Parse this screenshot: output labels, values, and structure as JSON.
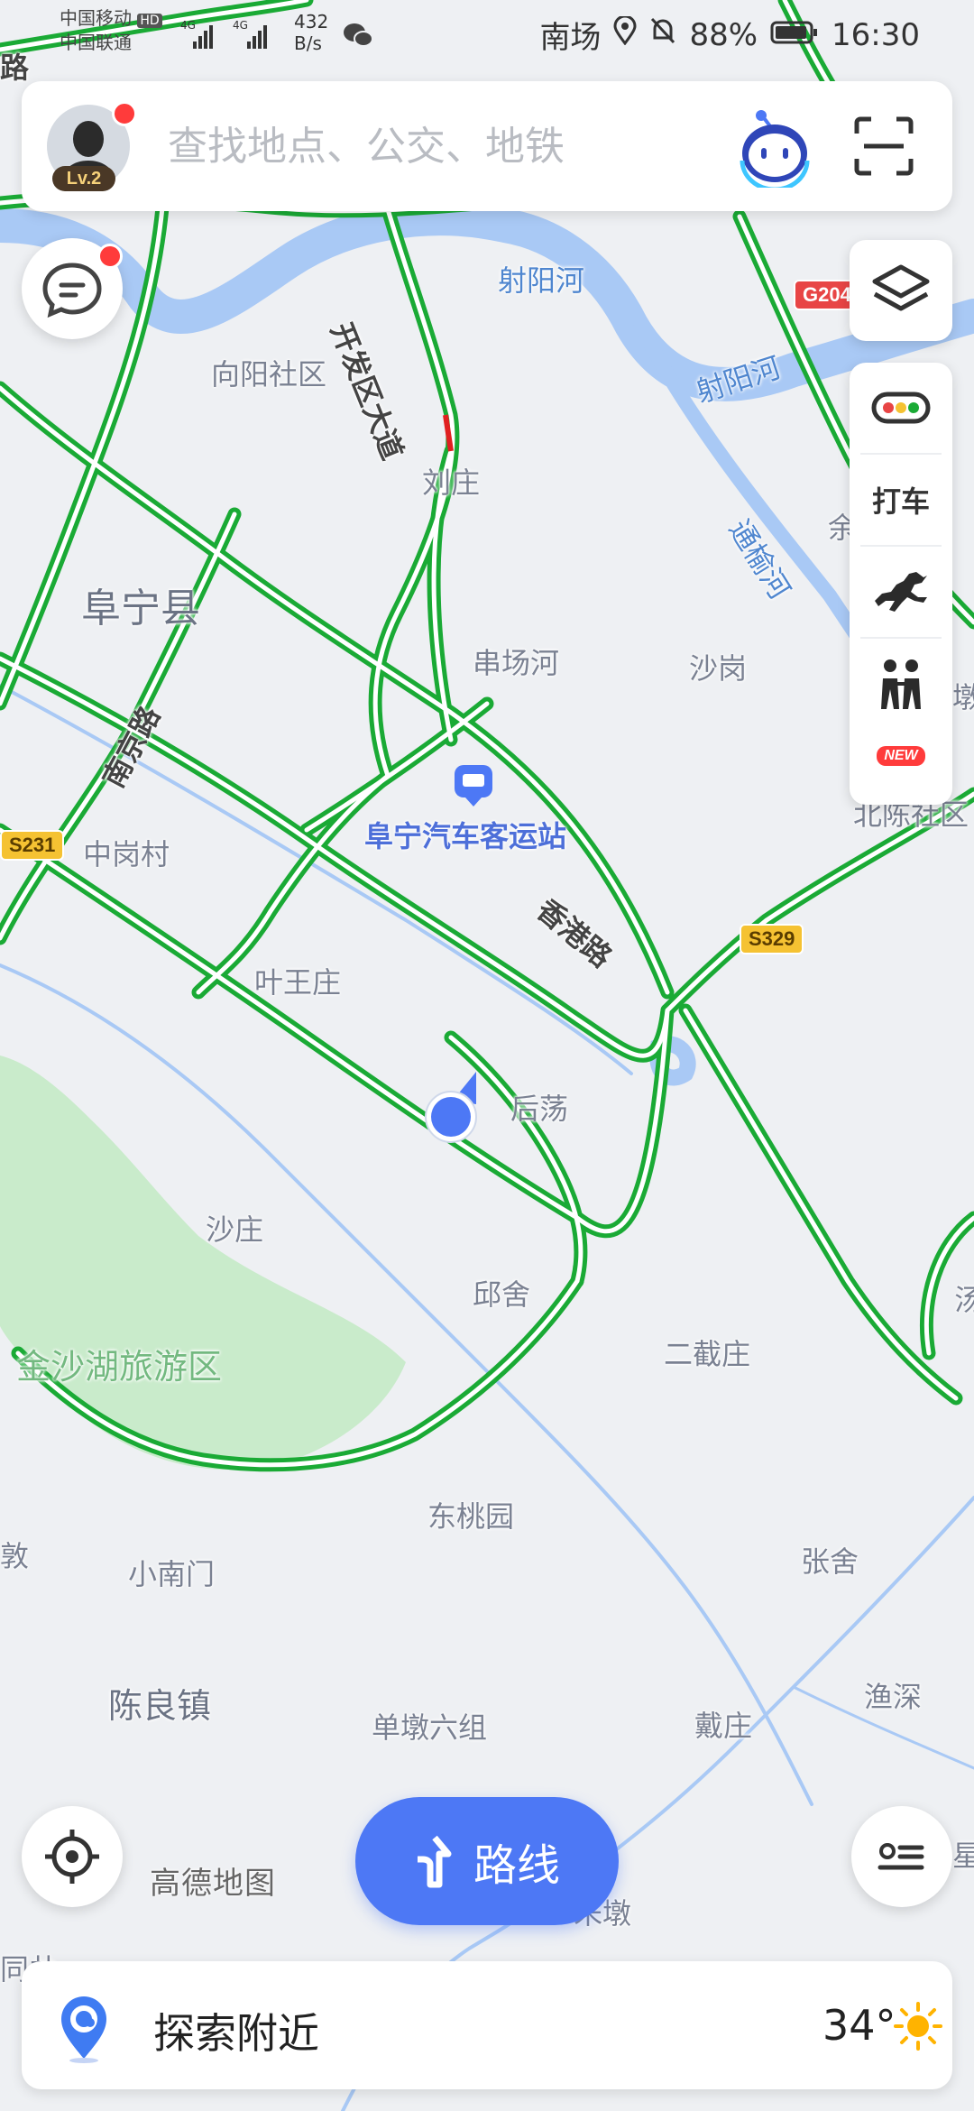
{
  "status_bar": {
    "carrier1": "中国移动",
    "carrier1_badge": "HD",
    "carrier2": "中国联通",
    "network": "4G",
    "net_speed_value": "432",
    "net_speed_unit": "B/s",
    "location": "南场",
    "battery": "88%",
    "time": "16:30"
  },
  "search": {
    "placeholder": "查找地点、公交、地铁",
    "level_badge": "Lv.2"
  },
  "side_tools": {
    "taxi_label": "打车",
    "new_badge": "NEW"
  },
  "map_labels": {
    "county": "阜宁县",
    "community1": "向阳社区",
    "river1": "射阳河",
    "river2": "射阳河",
    "river3": "通榆河",
    "road1": "开发区大道",
    "road2": "南京路",
    "road3": "香港路",
    "village1": "刘庄",
    "village2": "串场河",
    "village3": "沙岗",
    "village4": "中岗村",
    "village5": "叶王庄",
    "village6": "后荡",
    "village7": "沙庄",
    "village8": "邱舍",
    "village9": "二截庄",
    "village10": "东桃园",
    "village11": "小南门",
    "village12": "张舍",
    "village13": "陈良镇",
    "village14": "单墩六组",
    "village15": "戴庄",
    "village16": "渔深",
    "village17": "北陈社区",
    "village18": "朱墩",
    "poi1": "阜宁汽车客运站",
    "park1": "金沙湖旅游区",
    "edge_label1": "路",
    "edge_label2": "余",
    "edge_label3": "墩",
    "edge_label4": "汤",
    "edge_label5": "星",
    "edge_label6": "同共",
    "edge_label7": "敦"
  },
  "shields": {
    "g204": "G204",
    "s329": "S329",
    "s231": "S231"
  },
  "route_button": "路线",
  "map_brand": "高德地图",
  "bottom": {
    "explore": "探索附近",
    "temperature": "34°"
  }
}
